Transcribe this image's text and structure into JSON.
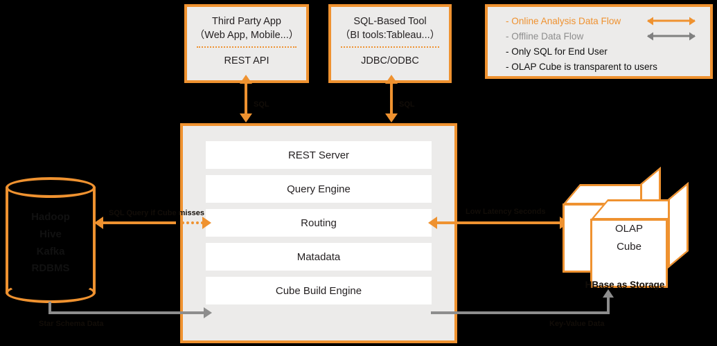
{
  "clients": {
    "third_party": {
      "title_line1": "Third Party App",
      "title_line2": "（Web App, Mobile...）",
      "api": "REST API"
    },
    "sql_tool": {
      "title_line1": "SQL-Based Tool",
      "title_line2": "（BI tools:Tableau...）",
      "api": "JDBC/ODBC"
    }
  },
  "legend": {
    "items": [
      {
        "label": "- Online Analysis Data Flow",
        "arrow": "double-arrow-orange-icon",
        "color": "#ef9230"
      },
      {
        "label": "- Offline Data Flow",
        "arrow": "double-arrow-gray-icon",
        "color": "#8d8d8d"
      },
      {
        "label": "- Only SQL for End User",
        "arrow": "",
        "color": "#111111"
      },
      {
        "label": "- OLAP Cube is transparent to users",
        "arrow": "",
        "color": "#111111"
      }
    ]
  },
  "kylin_panel": {
    "services": [
      "REST Server",
      "Query Engine",
      "Routing",
      "Matadata",
      "Cube Build Engine"
    ]
  },
  "datasource": {
    "lines": [
      "Hadoop",
      "Hive",
      "Kafka",
      "RDBMS"
    ],
    "caption": "Star Schema Data"
  },
  "storage": {
    "cube_line1": "OLAP",
    "cube_line2": "Cube",
    "caption": "HBase as Storage",
    "data_caption": "Key-Value Data"
  },
  "flow_labels": {
    "sql_left": "SQL",
    "sql_right": "SQL",
    "cube_miss": "SQL Query if Cube misses",
    "low_latency": "Low Latency Seconds"
  },
  "colors": {
    "accent_orange": "#ef9230",
    "gray_flow": "#8d8d8d",
    "panel_bg": "#ecebea",
    "row_bg": "#ffffff",
    "text": "#231f20"
  }
}
